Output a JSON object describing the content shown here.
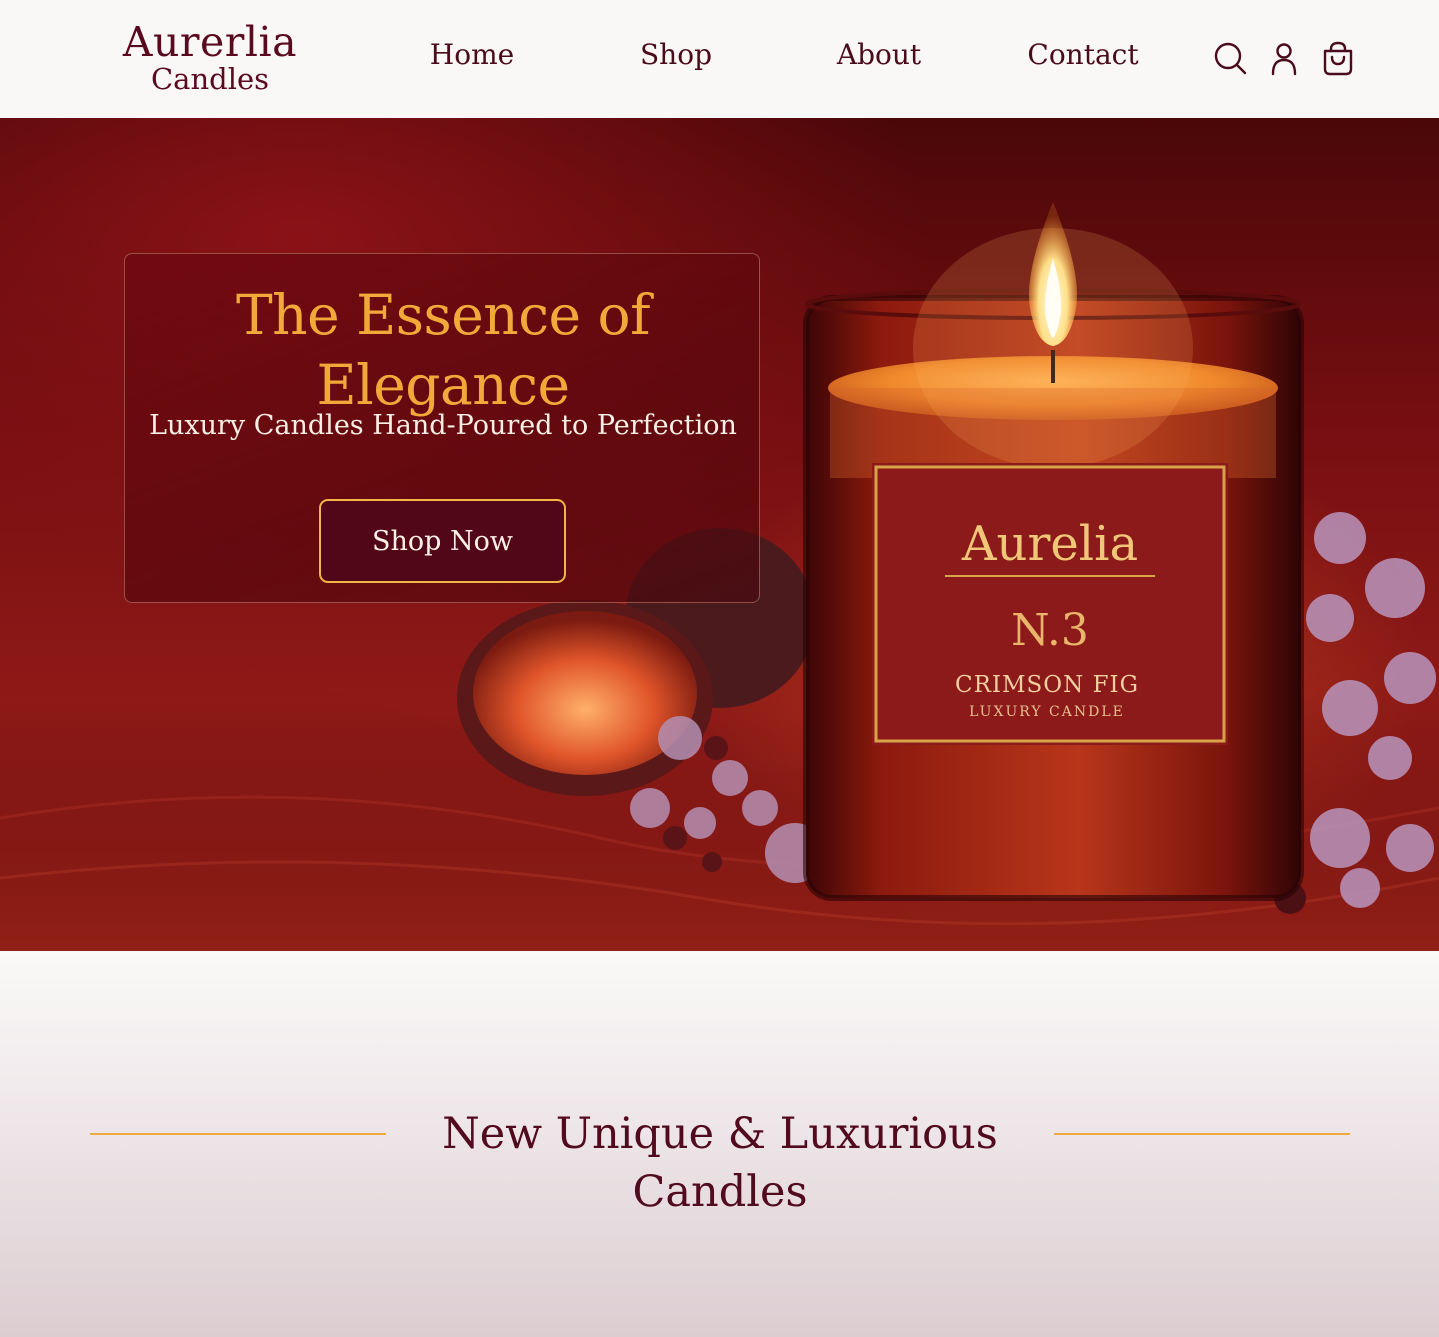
{
  "brand": {
    "name_line1": "Aurerlia",
    "name_line2": "Candles"
  },
  "nav": {
    "items": [
      {
        "label": "Home"
      },
      {
        "label": "Shop"
      },
      {
        "label": "About"
      },
      {
        "label": "Contact"
      }
    ],
    "icons": [
      "search-icon",
      "account-icon",
      "shopping-bag-icon"
    ]
  },
  "hero": {
    "title": "The Essence of Elegance",
    "subtitle": "Luxury Candles Hand-Poured to Perfection",
    "cta_label": "Shop Now",
    "candle_label": {
      "brand": "Aurelia",
      "number": "N.3",
      "name": "CRIMSON FIG",
      "type": "LUXURY CANDLE"
    }
  },
  "section": {
    "title": "New Unique & Luxurious Candles"
  },
  "colors": {
    "brand": "#5a0a1f",
    "accent_gold": "#f3a93a",
    "button_bg": "#520719",
    "hero_red": "#7a0f12"
  }
}
